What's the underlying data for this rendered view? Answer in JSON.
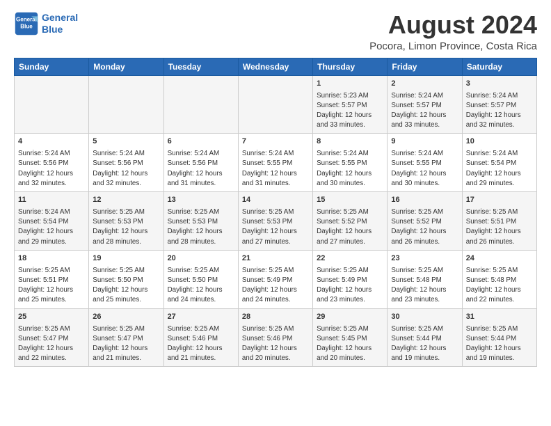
{
  "logo": {
    "line1": "General",
    "line2": "Blue"
  },
  "title": "August 2024",
  "subtitle": "Pocora, Limon Province, Costa Rica",
  "header_days": [
    "Sunday",
    "Monday",
    "Tuesday",
    "Wednesday",
    "Thursday",
    "Friday",
    "Saturday"
  ],
  "weeks": [
    [
      {
        "day": "",
        "info": ""
      },
      {
        "day": "",
        "info": ""
      },
      {
        "day": "",
        "info": ""
      },
      {
        "day": "",
        "info": ""
      },
      {
        "day": "1",
        "info": "Sunrise: 5:23 AM\nSunset: 5:57 PM\nDaylight: 12 hours\nand 33 minutes."
      },
      {
        "day": "2",
        "info": "Sunrise: 5:24 AM\nSunset: 5:57 PM\nDaylight: 12 hours\nand 33 minutes."
      },
      {
        "day": "3",
        "info": "Sunrise: 5:24 AM\nSunset: 5:57 PM\nDaylight: 12 hours\nand 32 minutes."
      }
    ],
    [
      {
        "day": "4",
        "info": "Sunrise: 5:24 AM\nSunset: 5:56 PM\nDaylight: 12 hours\nand 32 minutes."
      },
      {
        "day": "5",
        "info": "Sunrise: 5:24 AM\nSunset: 5:56 PM\nDaylight: 12 hours\nand 32 minutes."
      },
      {
        "day": "6",
        "info": "Sunrise: 5:24 AM\nSunset: 5:56 PM\nDaylight: 12 hours\nand 31 minutes."
      },
      {
        "day": "7",
        "info": "Sunrise: 5:24 AM\nSunset: 5:55 PM\nDaylight: 12 hours\nand 31 minutes."
      },
      {
        "day": "8",
        "info": "Sunrise: 5:24 AM\nSunset: 5:55 PM\nDaylight: 12 hours\nand 30 minutes."
      },
      {
        "day": "9",
        "info": "Sunrise: 5:24 AM\nSunset: 5:55 PM\nDaylight: 12 hours\nand 30 minutes."
      },
      {
        "day": "10",
        "info": "Sunrise: 5:24 AM\nSunset: 5:54 PM\nDaylight: 12 hours\nand 29 minutes."
      }
    ],
    [
      {
        "day": "11",
        "info": "Sunrise: 5:24 AM\nSunset: 5:54 PM\nDaylight: 12 hours\nand 29 minutes."
      },
      {
        "day": "12",
        "info": "Sunrise: 5:25 AM\nSunset: 5:53 PM\nDaylight: 12 hours\nand 28 minutes."
      },
      {
        "day": "13",
        "info": "Sunrise: 5:25 AM\nSunset: 5:53 PM\nDaylight: 12 hours\nand 28 minutes."
      },
      {
        "day": "14",
        "info": "Sunrise: 5:25 AM\nSunset: 5:53 PM\nDaylight: 12 hours\nand 27 minutes."
      },
      {
        "day": "15",
        "info": "Sunrise: 5:25 AM\nSunset: 5:52 PM\nDaylight: 12 hours\nand 27 minutes."
      },
      {
        "day": "16",
        "info": "Sunrise: 5:25 AM\nSunset: 5:52 PM\nDaylight: 12 hours\nand 26 minutes."
      },
      {
        "day": "17",
        "info": "Sunrise: 5:25 AM\nSunset: 5:51 PM\nDaylight: 12 hours\nand 26 minutes."
      }
    ],
    [
      {
        "day": "18",
        "info": "Sunrise: 5:25 AM\nSunset: 5:51 PM\nDaylight: 12 hours\nand 25 minutes."
      },
      {
        "day": "19",
        "info": "Sunrise: 5:25 AM\nSunset: 5:50 PM\nDaylight: 12 hours\nand 25 minutes."
      },
      {
        "day": "20",
        "info": "Sunrise: 5:25 AM\nSunset: 5:50 PM\nDaylight: 12 hours\nand 24 minutes."
      },
      {
        "day": "21",
        "info": "Sunrise: 5:25 AM\nSunset: 5:49 PM\nDaylight: 12 hours\nand 24 minutes."
      },
      {
        "day": "22",
        "info": "Sunrise: 5:25 AM\nSunset: 5:49 PM\nDaylight: 12 hours\nand 23 minutes."
      },
      {
        "day": "23",
        "info": "Sunrise: 5:25 AM\nSunset: 5:48 PM\nDaylight: 12 hours\nand 23 minutes."
      },
      {
        "day": "24",
        "info": "Sunrise: 5:25 AM\nSunset: 5:48 PM\nDaylight: 12 hours\nand 22 minutes."
      }
    ],
    [
      {
        "day": "25",
        "info": "Sunrise: 5:25 AM\nSunset: 5:47 PM\nDaylight: 12 hours\nand 22 minutes."
      },
      {
        "day": "26",
        "info": "Sunrise: 5:25 AM\nSunset: 5:47 PM\nDaylight: 12 hours\nand 21 minutes."
      },
      {
        "day": "27",
        "info": "Sunrise: 5:25 AM\nSunset: 5:46 PM\nDaylight: 12 hours\nand 21 minutes."
      },
      {
        "day": "28",
        "info": "Sunrise: 5:25 AM\nSunset: 5:46 PM\nDaylight: 12 hours\nand 20 minutes."
      },
      {
        "day": "29",
        "info": "Sunrise: 5:25 AM\nSunset: 5:45 PM\nDaylight: 12 hours\nand 20 minutes."
      },
      {
        "day": "30",
        "info": "Sunrise: 5:25 AM\nSunset: 5:44 PM\nDaylight: 12 hours\nand 19 minutes."
      },
      {
        "day": "31",
        "info": "Sunrise: 5:25 AM\nSunset: 5:44 PM\nDaylight: 12 hours\nand 19 minutes."
      }
    ]
  ]
}
